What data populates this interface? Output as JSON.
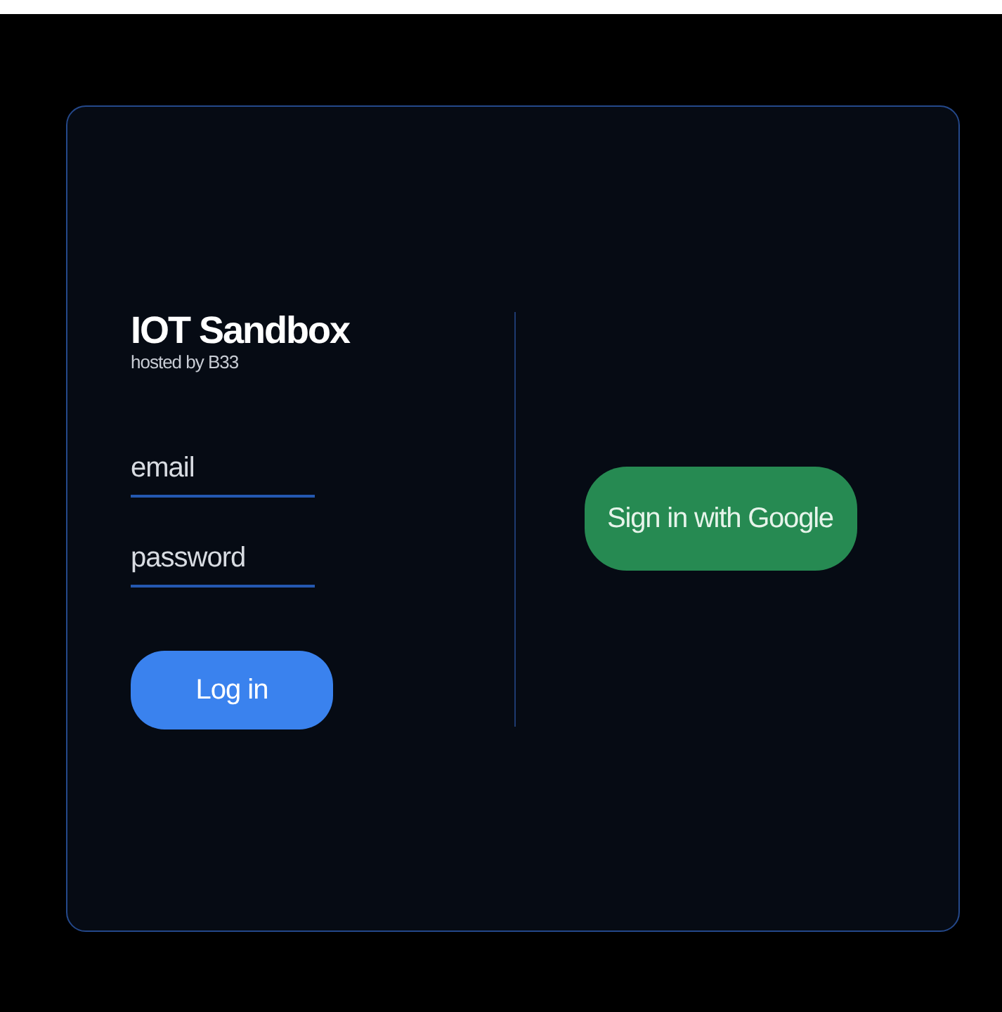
{
  "app": {
    "title": "IOT Sandbox",
    "subtitle": "hosted by B33"
  },
  "login_form": {
    "fields": [
      {
        "placeholder": "email"
      },
      {
        "placeholder": "password"
      }
    ],
    "login_button": "Log in"
  },
  "google_button": "Sign in with Google"
}
